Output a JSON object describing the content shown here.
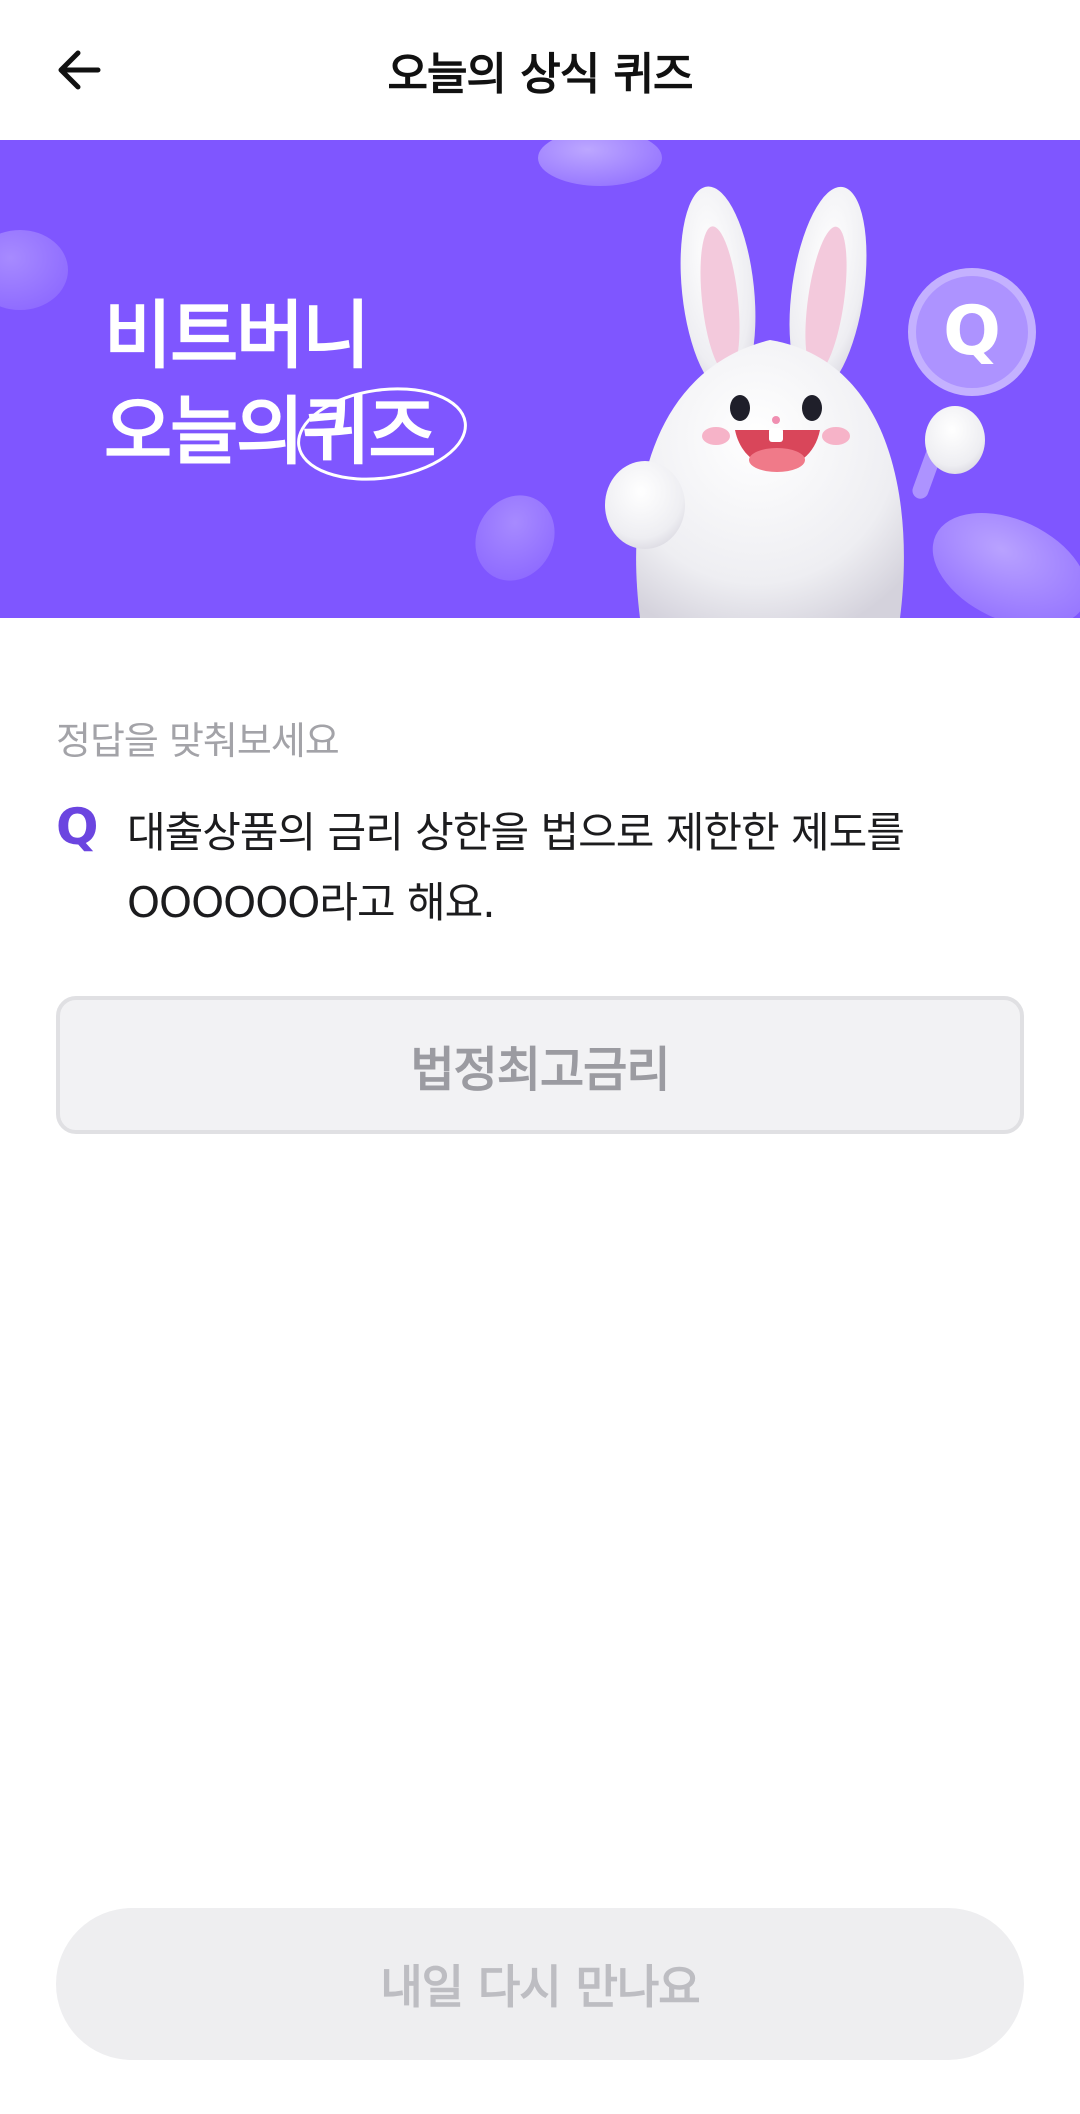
{
  "header": {
    "title": "오늘의 상식 퀴즈",
    "back_icon": "arrow-left-icon"
  },
  "banner": {
    "line1": "비트버니",
    "line2_prefix": "오늘의",
    "line2_circled": "퀴즈",
    "badge_letter": "Q",
    "background_color": "#7f56ff"
  },
  "quiz": {
    "hint": "정답을 맞춰보세요",
    "q_mark": "Q",
    "question_line1": "대출상품의 금리 상한을 법으로 제한한 제도를",
    "question_line2": "OOOOOO라고 해요.",
    "answer": "법정최고금리",
    "accent_color": "#6b45e0"
  },
  "cta": {
    "label": "내일 다시 만나요"
  }
}
